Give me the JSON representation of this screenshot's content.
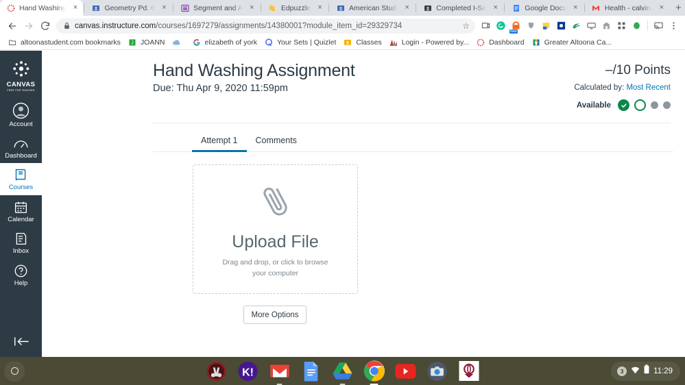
{
  "browser": {
    "tabs": [
      {
        "title": "Hand Washing",
        "icon": "canvas-icon",
        "active": true
      },
      {
        "title": "Geometry Pd. 6",
        "icon": "classroom-icon",
        "active": false
      },
      {
        "title": "Segment and A",
        "icon": "slides-icon",
        "active": false
      },
      {
        "title": "Edpuzzle",
        "icon": "edpuzzle-icon",
        "active": false
      },
      {
        "title": "American Studi",
        "icon": "classroom-icon",
        "active": false
      },
      {
        "title": "Completed I-Se",
        "icon": "classroom-icon",
        "active": false
      },
      {
        "title": "Google Docs",
        "icon": "docs-icon",
        "active": false
      },
      {
        "title": "Health - calvin.",
        "icon": "gmail-icon",
        "active": false
      }
    ],
    "new_tab_label": "+",
    "close_label": "×",
    "window_controls": {
      "minimize": "–",
      "maximize": "❐",
      "close": "✕"
    },
    "nav": {
      "back": "←",
      "forward": "→",
      "reload": "↻"
    },
    "url": {
      "host": "canvas.instructure.com",
      "path": "/courses/1697279/assignments/14380001?module_item_id=29329734",
      "lock": "lock-icon",
      "star": "☆"
    },
    "extensions": [
      "screencast-icon",
      "grammarly-icon",
      "honey-icon",
      "pocket-icon",
      "sticky-note-icon",
      "blue-square-icon",
      "green-swirl-icon",
      "tv-icon",
      "gray-building-icon",
      "grid-icon",
      "green-drop-icon"
    ],
    "menu_icon": "kebab-menu-icon",
    "cast_icon": "cast-icon",
    "bookmarks": [
      {
        "label": "altoonastudent.com bookmarks",
        "icon": "folder-icon"
      },
      {
        "label": "JOANN",
        "icon": "joann-icon"
      },
      {
        "label": "",
        "icon": "cloud-icon"
      },
      {
        "label": "elizabeth of york",
        "icon": "google-icon"
      },
      {
        "label": "Your Sets | Quizlet",
        "icon": "quizlet-icon"
      },
      {
        "label": "Classes",
        "icon": "classroom-icon"
      },
      {
        "label": "Login - Powered by...",
        "icon": "login-icon"
      },
      {
        "label": "Dashboard",
        "icon": "canvas-icon"
      },
      {
        "label": "Greater Altoona Ca...",
        "icon": "altoona-icon"
      }
    ]
  },
  "sidebar": {
    "logo_text": "CANVAS",
    "logo_sub": "FREE FOR TEACHER",
    "items": [
      {
        "label": "Account",
        "icon": "account-avatar-icon",
        "active": false
      },
      {
        "label": "Dashboard",
        "icon": "dashboard-icon",
        "active": false
      },
      {
        "label": "Courses",
        "icon": "courses-icon",
        "active": true
      },
      {
        "label": "Calendar",
        "icon": "calendar-icon",
        "active": false
      },
      {
        "label": "Inbox",
        "icon": "inbox-icon",
        "active": false
      },
      {
        "label": "Help",
        "icon": "help-icon",
        "active": false
      }
    ],
    "collapse_icon": "collapse-arrow-icon"
  },
  "assignment": {
    "title": "Hand Washing Assignment",
    "due": "Due: Thu Apr 9, 2020 11:59pm",
    "points": "–/10 Points",
    "calculated_prefix": "Calculated by: ",
    "calculated_value": "Most Recent",
    "available_label": "Available",
    "status_pills": [
      "complete",
      "current",
      "dot",
      "dot"
    ],
    "tabs": [
      {
        "label": "Attempt 1",
        "active": true
      },
      {
        "label": "Comments",
        "active": false
      }
    ],
    "upload": {
      "icon": "paperclip-icon",
      "title": "Upload File",
      "subtitle": "Drag and drop, or click to browse your computer"
    },
    "more_options_label": "More Options"
  },
  "shelf": {
    "launcher_icon": "launcher-circle-icon",
    "apps": [
      {
        "name": "music-app-icon",
        "running": false
      },
      {
        "name": "kahoot-icon",
        "running": false
      },
      {
        "name": "gmail-icon",
        "running": true
      },
      {
        "name": "google-docs-icon",
        "running": false
      },
      {
        "name": "google-drive-icon",
        "running": true
      },
      {
        "name": "chrome-icon",
        "running": true
      },
      {
        "name": "youtube-icon",
        "running": false
      },
      {
        "name": "camera-icon",
        "running": false
      },
      {
        "name": "school-app-icon",
        "running": false
      }
    ],
    "tray": {
      "notification_count": "3",
      "wifi_icon": "wifi-icon",
      "battery_icon": "battery-icon",
      "time": "11:29"
    }
  },
  "colors": {
    "canvas_nav": "#2d3b45",
    "accent_blue": "#0374b5",
    "status_green": "#0b874b",
    "shelf": "#4a4a35"
  }
}
